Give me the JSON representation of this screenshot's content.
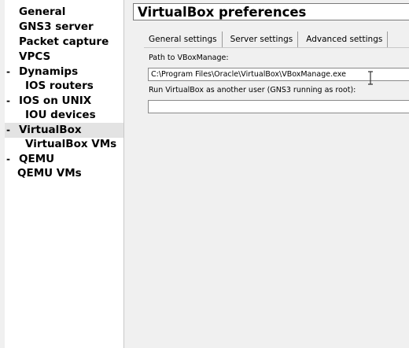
{
  "sidebar": {
    "items": [
      {
        "label": "General"
      },
      {
        "label": "GNS3 server"
      },
      {
        "label": "Packet capture"
      },
      {
        "label": "VPCS"
      },
      {
        "label": "Dynamips",
        "toggle": "-"
      },
      {
        "label": "IOS routers"
      },
      {
        "label": "IOS on UNIX",
        "toggle": "-"
      },
      {
        "label": "IOU devices"
      },
      {
        "label": "VirtualBox",
        "toggle": "-"
      },
      {
        "label": "VirtualBox VMs"
      },
      {
        "label": "QEMU",
        "toggle": "-"
      },
      {
        "label": "QEMU VMs"
      }
    ],
    "selected": "VirtualBox"
  },
  "main": {
    "title": "VirtualBox preferences",
    "tabs": [
      {
        "label": "General settings"
      },
      {
        "label": "Server settings"
      },
      {
        "label": "Advanced settings"
      }
    ],
    "active_tab": "General settings",
    "fields": {
      "vboxmanage_path": {
        "label": "Path to VBoxManage:",
        "value": "C:\\Program Files\\Oracle\\VirtualBox\\VBoxManage.exe"
      },
      "run_as_user": {
        "label": "Run VirtualBox as another user (GNS3 running as root):",
        "value": ""
      }
    }
  },
  "colors": {
    "panel_bg": "#f0f0f0",
    "tree_bg": "#ffffff",
    "selected_bg": "#e3e3e3"
  }
}
